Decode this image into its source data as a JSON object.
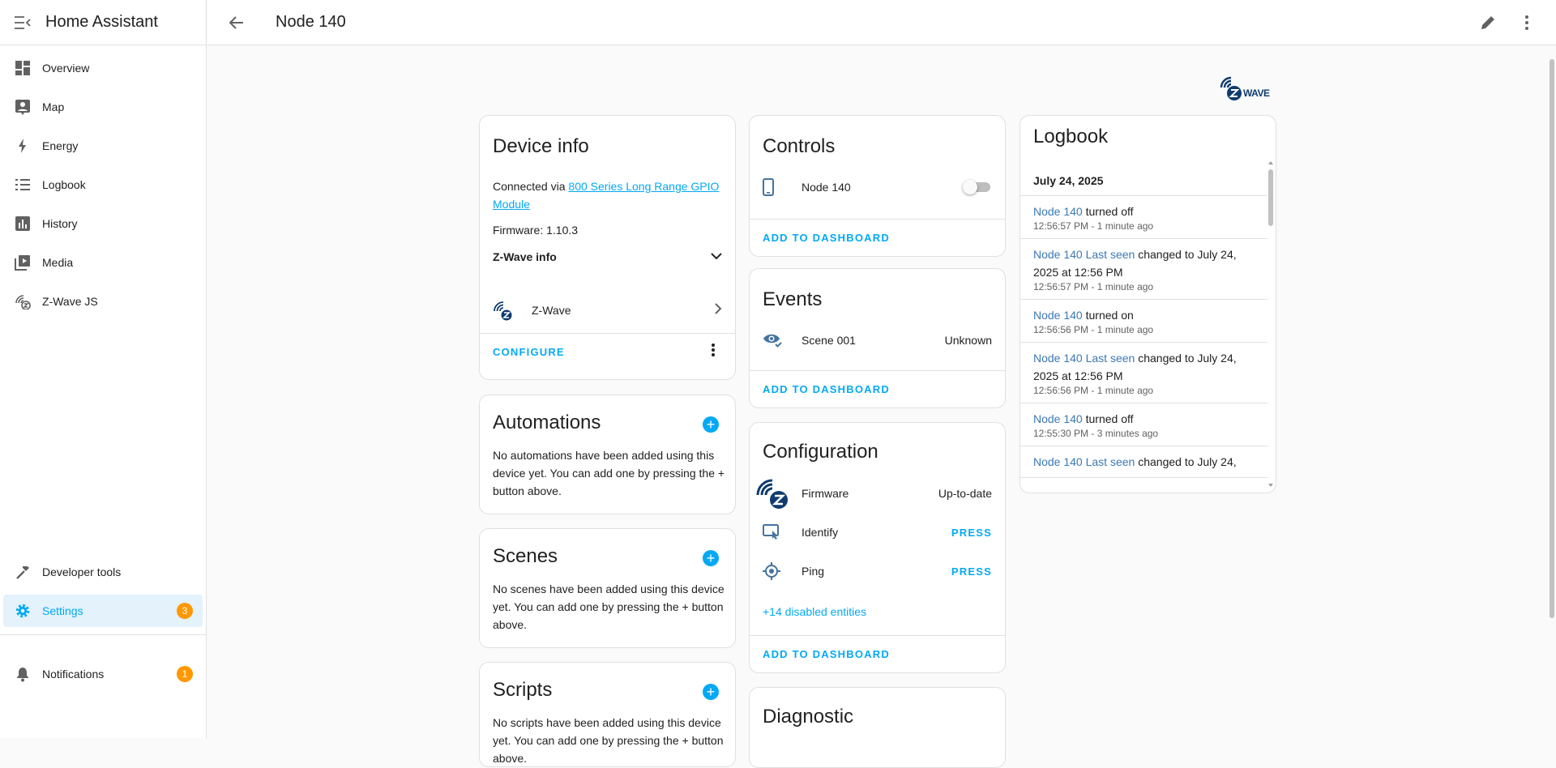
{
  "app": {
    "title": "Home Assistant"
  },
  "sidebar": {
    "items": [
      {
        "label": "Overview",
        "icon": "dashboard-icon"
      },
      {
        "label": "Map",
        "icon": "map-icon"
      },
      {
        "label": "Energy",
        "icon": "lightning-icon"
      },
      {
        "label": "Logbook",
        "icon": "logbook-icon"
      },
      {
        "label": "History",
        "icon": "chart-icon"
      },
      {
        "label": "Media",
        "icon": "media-icon"
      },
      {
        "label": "Z-Wave JS",
        "icon": "zwave-icon"
      }
    ],
    "developer_tools": "Developer tools",
    "settings": {
      "label": "Settings",
      "badge": "3"
    },
    "notifications": {
      "label": "Notifications",
      "badge": "1"
    }
  },
  "header": {
    "title": "Node 140"
  },
  "brand_logo": "WAVE",
  "device_info": {
    "title": "Device info",
    "connected_via_prefix": "Connected via ",
    "connected_via_link": "800 Series Long Range GPIO Module",
    "firmware": "Firmware: 1.10.3",
    "zwave_info": "Z-Wave info",
    "integration": "Z-Wave",
    "configure": "CONFIGURE"
  },
  "automations": {
    "title": "Automations",
    "text": "No automations have been added using this device yet. You can add one by pressing the + button above."
  },
  "scenes": {
    "title": "Scenes",
    "text": "No scenes have been added using this device yet. You can add one by pressing the + button above."
  },
  "scripts": {
    "title": "Scripts",
    "text": "No scripts have been added using this device yet. You can add one by pressing the + button above."
  },
  "controls": {
    "title": "Controls",
    "entity": "Node 140",
    "toggle_on": false,
    "add": "ADD TO DASHBOARD"
  },
  "events": {
    "title": "Events",
    "entity": "Scene 001",
    "state": "Unknown",
    "add": "ADD TO DASHBOARD"
  },
  "configuration": {
    "title": "Configuration",
    "rows": [
      {
        "name": "Firmware",
        "state": "Up-to-date"
      },
      {
        "name": "Identify",
        "state": "PRESS"
      },
      {
        "name": "Ping",
        "state": "PRESS"
      }
    ],
    "disabled": "+14 disabled entities",
    "add": "ADD TO DASHBOARD"
  },
  "diagnostic": {
    "title": "Diagnostic"
  },
  "logbook": {
    "title": "Logbook",
    "date": "July 24, 2025",
    "entries": [
      {
        "entity": "Node 140",
        "message": " turned off",
        "time": "12:56:57 PM - 1 minute ago"
      },
      {
        "entity": "Node 140 Last seen",
        "message": " changed to July 24, 2025 at 12:56 PM",
        "time": "12:56:57 PM - 1 minute ago"
      },
      {
        "entity": "Node 140",
        "message": " turned on",
        "time": "12:56:56 PM - 1 minute ago"
      },
      {
        "entity": "Node 140 Last seen",
        "message": " changed to July 24, 2025 at 12:56 PM",
        "time": "12:56:56 PM - 1 minute ago"
      },
      {
        "entity": "Node 140",
        "message": " turned off",
        "time": "12:55:30 PM - 3 minutes ago"
      },
      {
        "entity": "Node 140 Last seen",
        "message": " changed to July 24,",
        "time": ""
      }
    ]
  },
  "colors": {
    "accent": "#03a9f4",
    "badge": "#ff9800",
    "entity_link": "#3c78b4"
  }
}
